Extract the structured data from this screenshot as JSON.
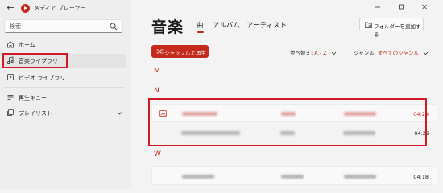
{
  "app": {
    "title": "メディア プレーヤー"
  },
  "search": {
    "placeholder": "検索"
  },
  "nav": {
    "items": [
      {
        "label": "ホーム"
      },
      {
        "label": "音楽ライブラリ"
      },
      {
        "label": "ビデオ ライブラリ"
      },
      {
        "label": "再生キュー"
      },
      {
        "label": "プレイリスト"
      }
    ]
  },
  "main": {
    "title": "音楽",
    "tabs": [
      {
        "label": "曲"
      },
      {
        "label": "アルバム"
      },
      {
        "label": "アーティスト"
      }
    ],
    "add_folder_label": "フォルダーを追加する",
    "shuffle_label": "シャッフルと再生",
    "sort": {
      "label": "並べ替え:",
      "value": "A - Z"
    },
    "genre": {
      "label": "ジャンル:",
      "value": "すべてのジャンル"
    },
    "groups": [
      {
        "letter": "M",
        "rows": []
      },
      {
        "letter": "N",
        "rows": [
          {
            "duration": "04:29"
          },
          {
            "duration": "04:29"
          }
        ]
      },
      {
        "letter": "W",
        "rows": [
          {
            "duration": "04:18"
          }
        ]
      }
    ]
  },
  "colors": {
    "accent": "#c42b1c",
    "highlight_box": "#d01926"
  }
}
